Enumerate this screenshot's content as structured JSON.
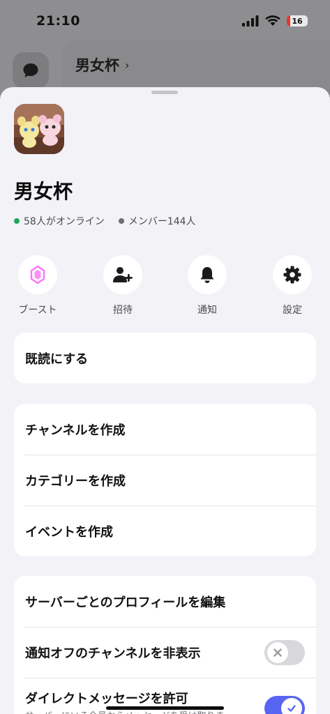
{
  "status_bar": {
    "time": "21:10",
    "battery_level": "16",
    "battery_color": "#e0392d"
  },
  "background": {
    "server_title": "男女杯",
    "chevron": "›"
  },
  "sheet": {
    "server_name": "男女杯",
    "online_text": "58人がオンライン",
    "online_color": "#23a55a",
    "members_text": "メンバー144人",
    "members_color": "#6e6e73",
    "actions": [
      {
        "label": "ブースト",
        "icon": "boost-gem-icon"
      },
      {
        "label": "招待",
        "icon": "invite-user-icon"
      },
      {
        "label": "通知",
        "icon": "bell-icon"
      },
      {
        "label": "設定",
        "icon": "gear-icon"
      }
    ],
    "mark_read": "既読にする",
    "create_group": [
      {
        "label": "チャンネルを作成"
      },
      {
        "label": "カテゴリーを作成"
      },
      {
        "label": "イベントを作成"
      }
    ],
    "settings_group": {
      "edit_profile": "サーバーごとのプロフィールを編集",
      "hide_muted": "通知オフのチャンネルを非表示",
      "hide_muted_on": false,
      "allow_dm": "ダイレクトメッセージを許可",
      "allow_dm_sub": "サーバーにいる全員からメッセージを受け取りま",
      "allow_dm_on": true
    },
    "accent_color": "#5865f2"
  }
}
